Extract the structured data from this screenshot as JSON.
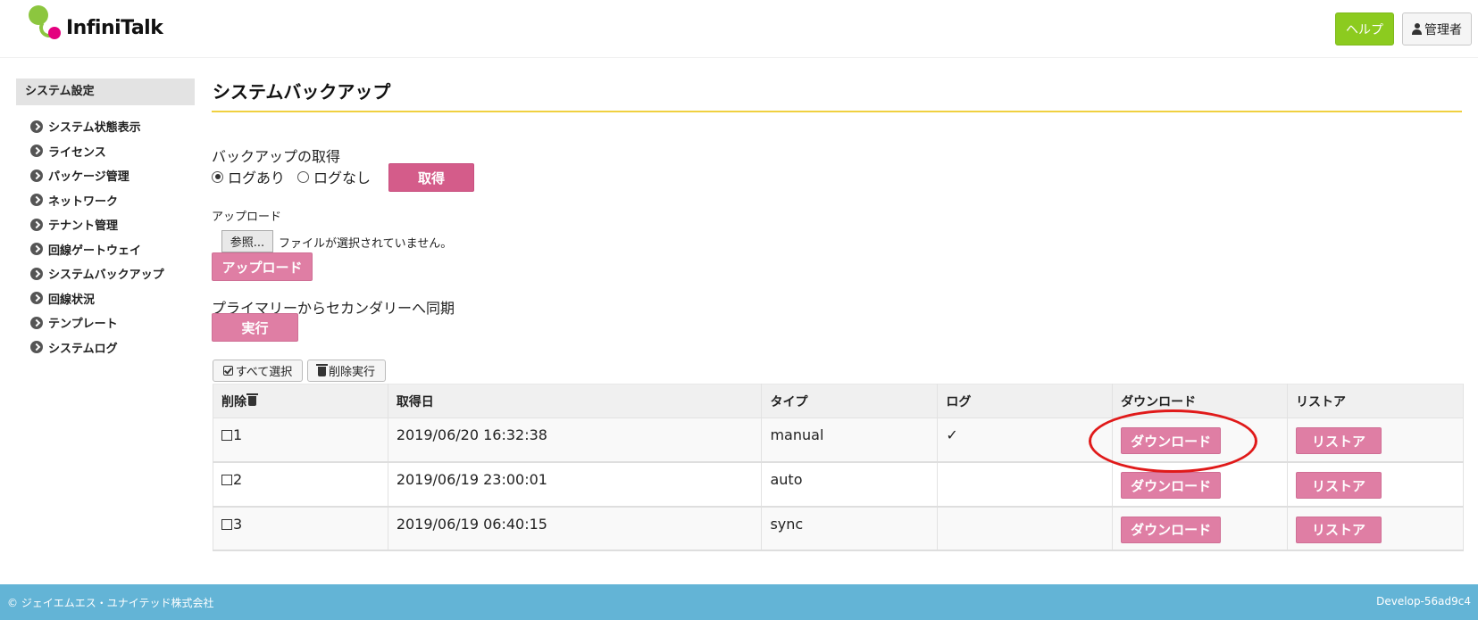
{
  "header": {
    "logo_text": "InfiniTalk",
    "help_label": "ヘルプ",
    "admin_label": "管理者"
  },
  "sidebar": {
    "title": "システム設定",
    "items": [
      {
        "label": "システム状態表示"
      },
      {
        "label": "ライセンス"
      },
      {
        "label": "パッケージ管理"
      },
      {
        "label": "ネットワーク"
      },
      {
        "label": "テナント管理"
      },
      {
        "label": "回線ゲートウェイ"
      },
      {
        "label": "システムバックアップ"
      },
      {
        "label": "回線状況"
      },
      {
        "label": "テンプレート"
      },
      {
        "label": "システムログ"
      }
    ]
  },
  "main": {
    "title": "システムバックアップ",
    "backup": {
      "heading": "バックアップの取得",
      "option_with_log": "ログあり",
      "option_without_log": "ログなし",
      "selected_option": "ログあり",
      "get_button": "取得"
    },
    "upload": {
      "heading": "アップロード",
      "browse_button": "参照...",
      "file_status": "ファイルが選択されていません。",
      "upload_button": "アップロード"
    },
    "sync": {
      "heading": "プライマリーからセカンダリーへ同期",
      "run_button": "実行"
    },
    "table_actions": {
      "select_all": "すべて選択",
      "delete_run": "削除実行"
    },
    "table": {
      "columns": [
        "削除",
        "取得日",
        "タイプ",
        "ログ",
        "ダウンロード",
        "リストア"
      ],
      "rows": [
        {
          "id": "1",
          "date": "2019/06/20 16:32:38",
          "type": "manual",
          "log": "✓",
          "download": "ダウンロード",
          "restore": "リストア"
        },
        {
          "id": "2",
          "date": "2019/06/19 23:00:01",
          "type": "auto",
          "log": "",
          "download": "ダウンロード",
          "restore": "リストア"
        },
        {
          "id": "3",
          "date": "2019/06/19 06:40:15",
          "type": "sync",
          "log": "",
          "download": "ダウンロード",
          "restore": "リストア"
        }
      ]
    }
  },
  "footer": {
    "copyright": "© ジェイエムエス・ユナイテッド株式会社",
    "version": "Develop-56ad9c4"
  },
  "colors": {
    "accent_green": "#8ccb1f",
    "button_pink": "#df7ea4",
    "title_underline": "#f0d040",
    "footer_blue": "#63b4d6",
    "highlight_red": "#e01a1a"
  }
}
